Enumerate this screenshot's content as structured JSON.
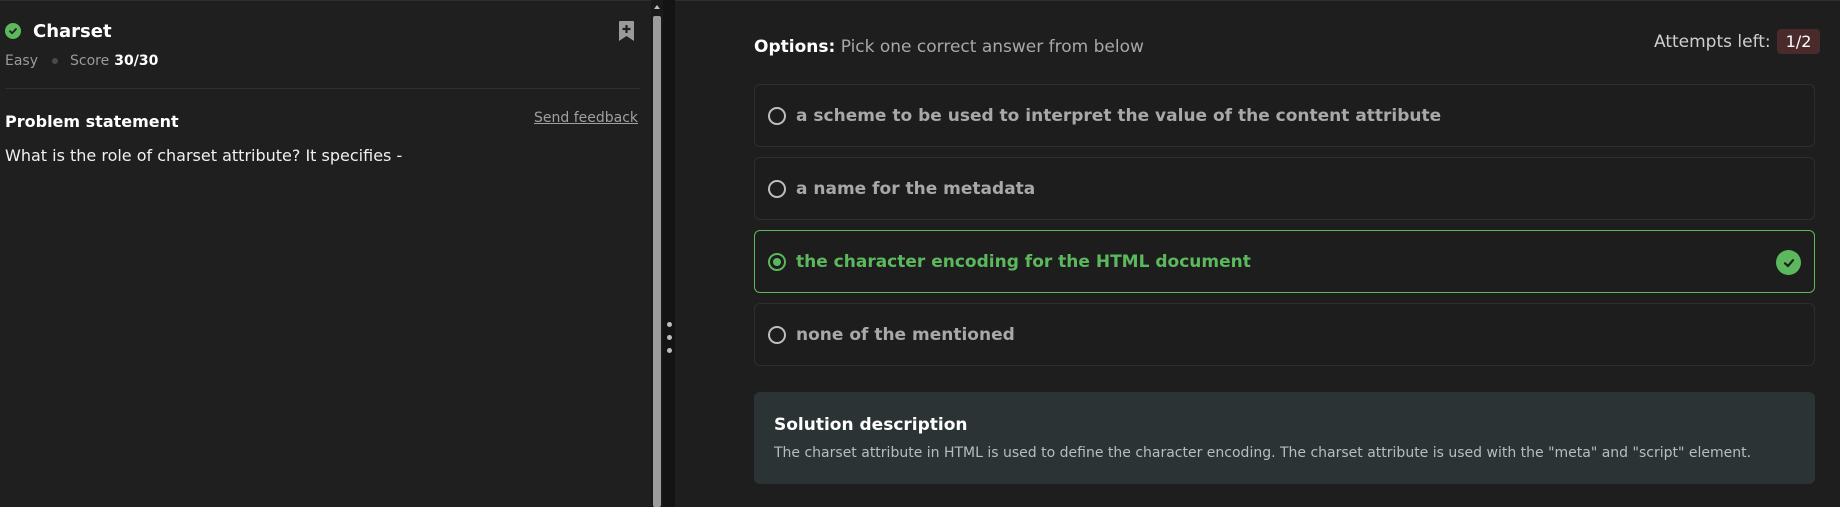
{
  "problem": {
    "title": "Charset",
    "difficulty": "Easy",
    "score_label": "Score",
    "score_value": "30/30",
    "statement_heading": "Problem statement",
    "feedback_link": "Send feedback",
    "question": "What is the role of charset attribute? It specifies -"
  },
  "options_panel": {
    "label": "Options:",
    "hint": "Pick one correct answer from below",
    "attempts_label": "Attempts left:",
    "attempts_value": "1/2",
    "options": [
      {
        "text": "a scheme to be used to interpret the value of the content attribute",
        "selected": false,
        "correct": false
      },
      {
        "text": "a name for the metadata",
        "selected": false,
        "correct": false
      },
      {
        "text": "the character encoding for the HTML document",
        "selected": true,
        "correct": true
      },
      {
        "text": "none of the mentioned",
        "selected": false,
        "correct": false
      }
    ]
  },
  "solution": {
    "title": "Solution description",
    "text": "The charset attribute in HTML is used to define the character encoding. The charset attribute is used with the \"meta\" and \"script\" element."
  },
  "colors": {
    "success": "#5cb85c",
    "background": "#1e1e1e",
    "solution_bg": "#2b3335",
    "attempts_badge_bg": "#4a2a2a"
  },
  "icons": {
    "solved": "check-circle-icon",
    "bookmark": "bookmark-add-icon",
    "correct": "check-circle-icon",
    "splitter": "vertical-grip-icon"
  }
}
